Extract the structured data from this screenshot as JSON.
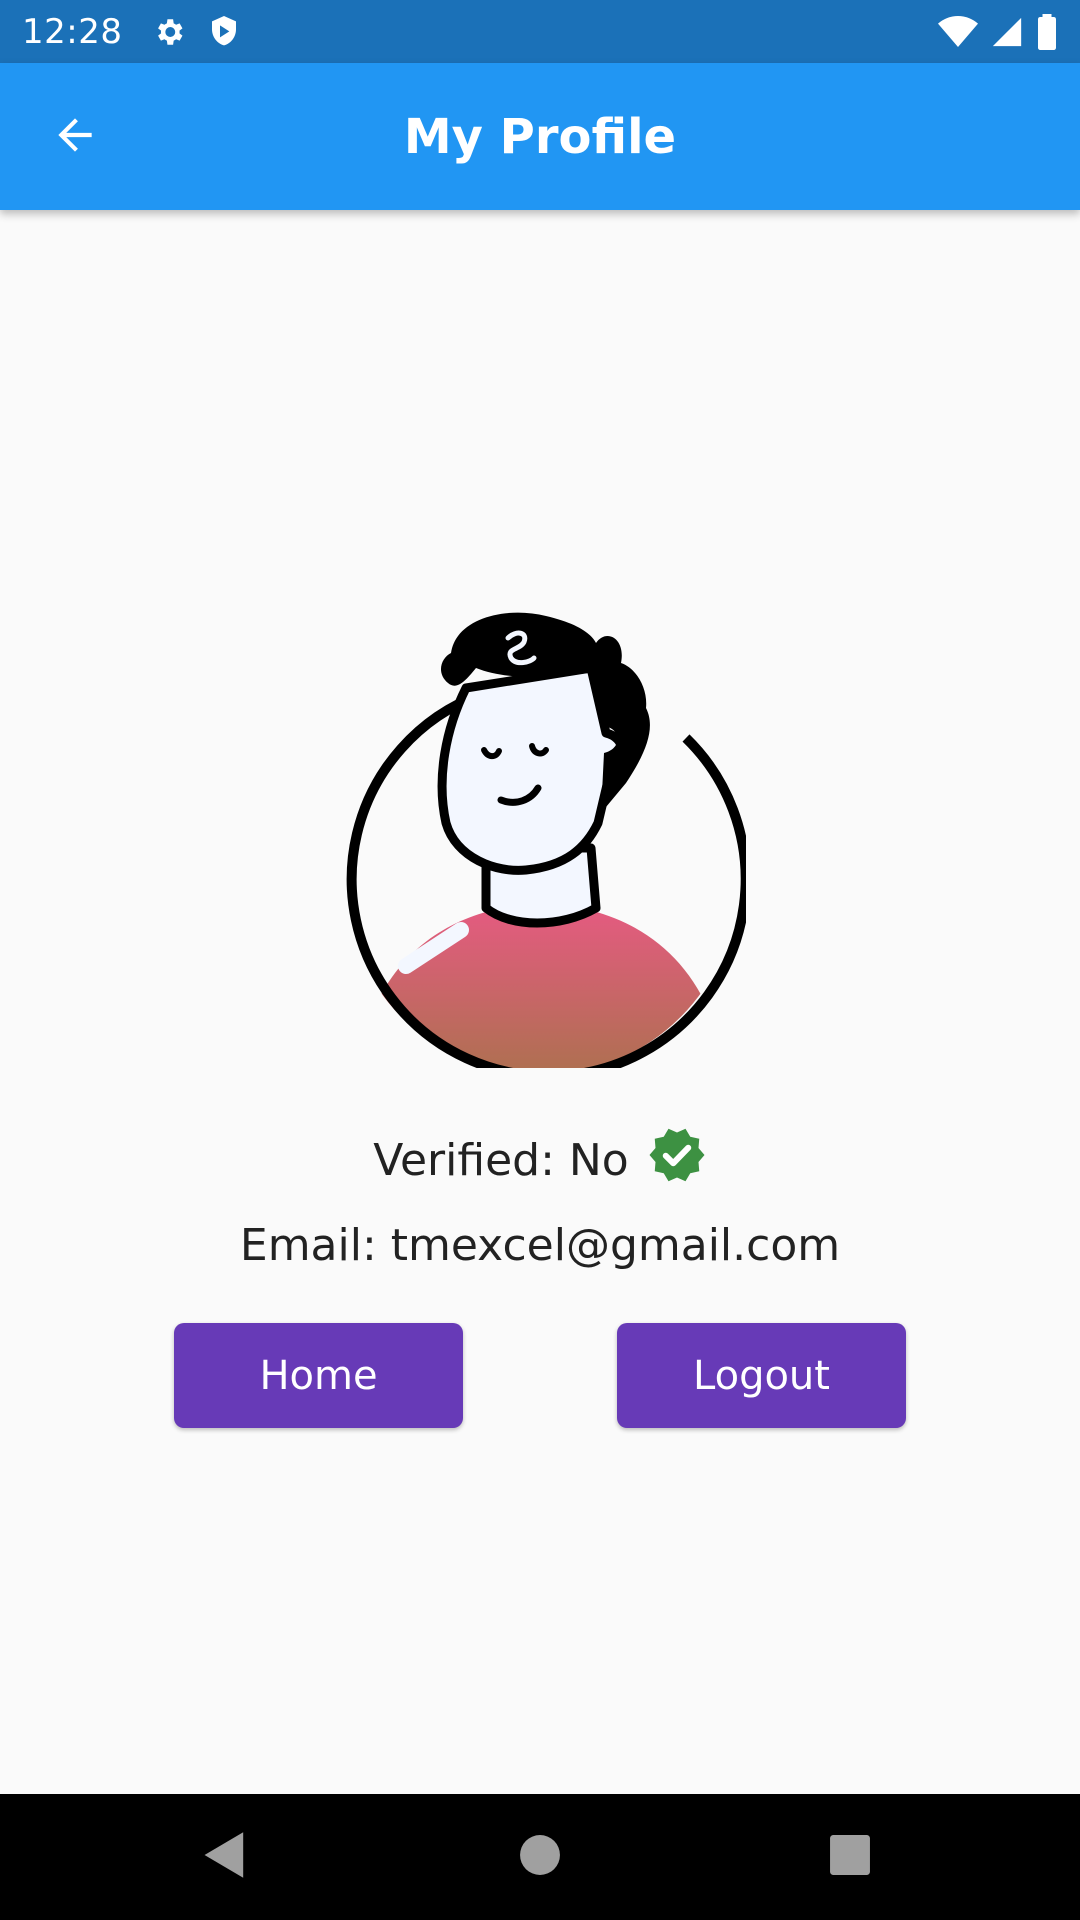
{
  "status_bar": {
    "time": "12:28",
    "icons_left": [
      "gear-icon",
      "shield-icon"
    ],
    "icons_right": [
      "wifi-icon",
      "signal-icon",
      "battery-icon"
    ]
  },
  "app_bar": {
    "title": "My Profile",
    "back_icon": "arrow-back-icon"
  },
  "profile": {
    "avatar_icon": "avatar-illustration",
    "verified_text": "Verified: No",
    "verified_icon": "verified-badge-icon",
    "email_text": "Email: tmexcel@gmail.com"
  },
  "actions": {
    "home_label": "Home",
    "logout_label": "Logout"
  },
  "nav_bar": {
    "icons": [
      "nav-back-icon",
      "nav-home-icon",
      "nav-recent-icon"
    ]
  },
  "colors": {
    "status_bar": "#1b71b8",
    "app_bar": "#2196f3",
    "button": "#673ab7",
    "verified_badge": "#3d9142",
    "shirt": "#e05a7c"
  }
}
